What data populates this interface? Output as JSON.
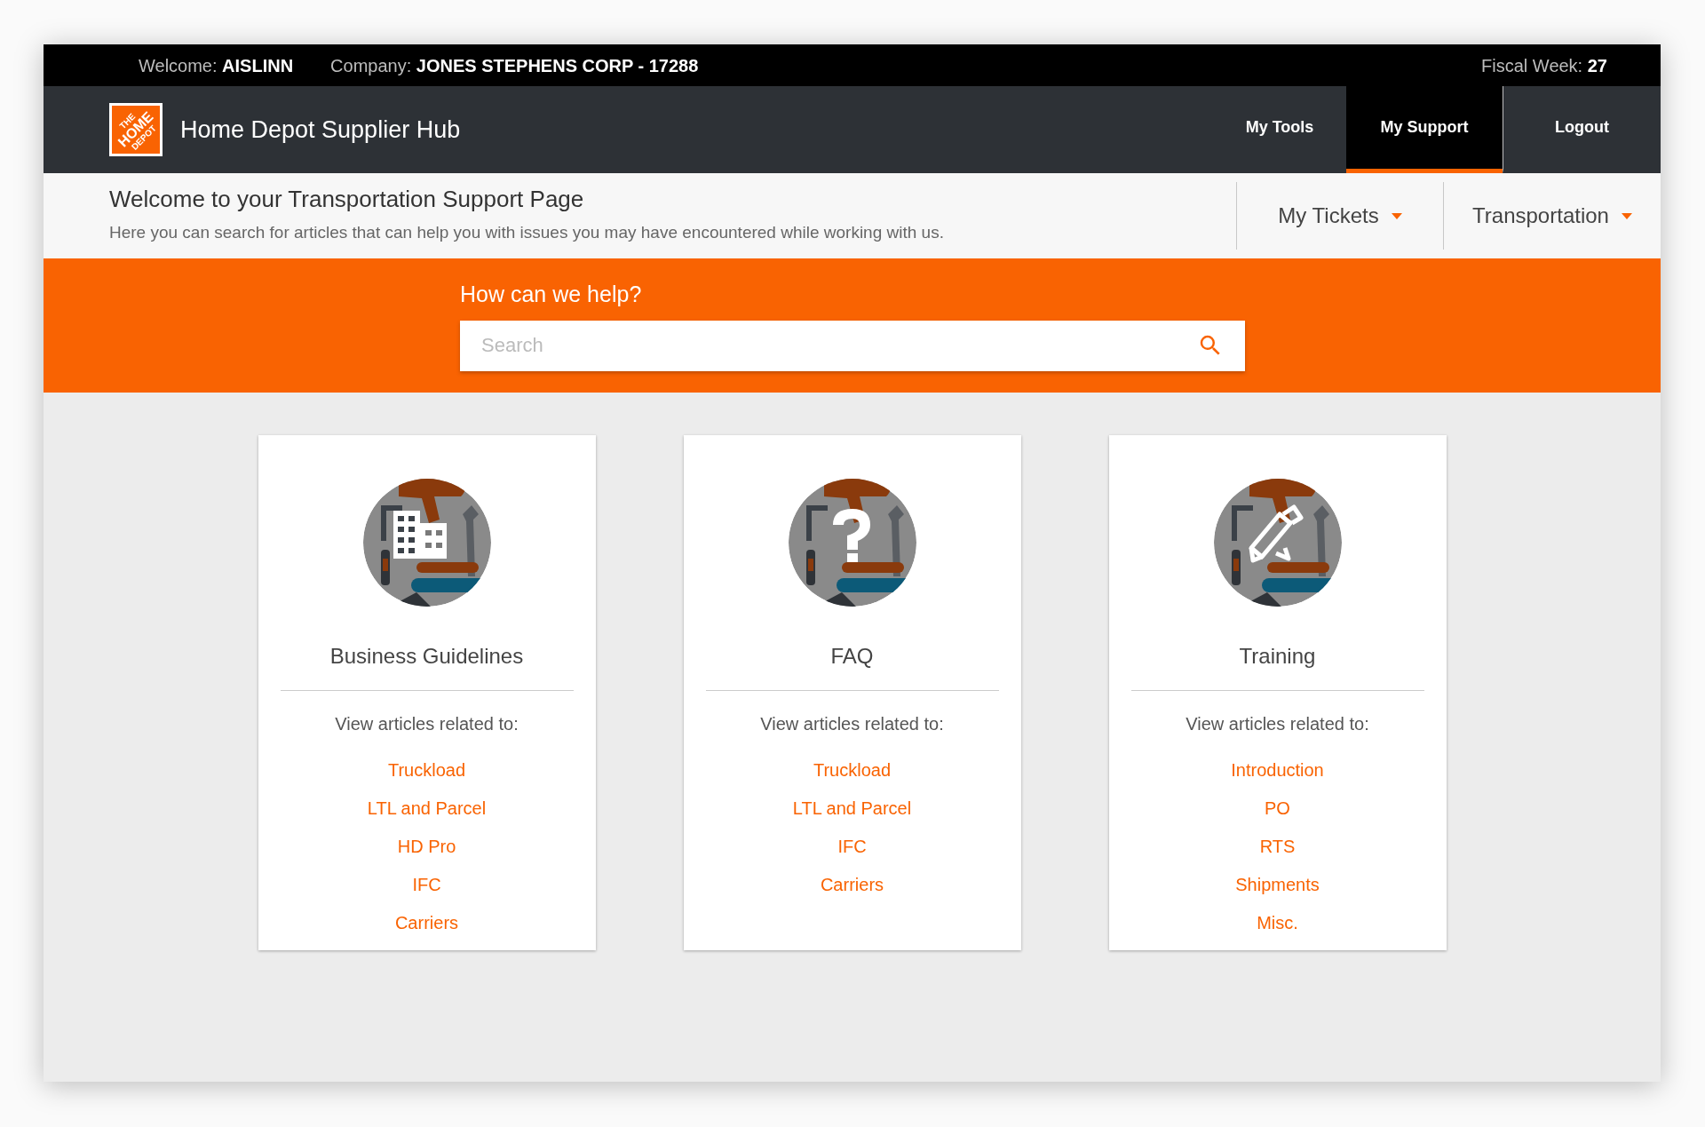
{
  "top_bar": {
    "welcome_label": "Welcome:",
    "welcome_value": "AISLINN",
    "company_label": "Company:",
    "company_value": "JONES STEPHENS CORP - 17288",
    "fiscal_label": "Fiscal Week:",
    "fiscal_value": "27"
  },
  "header": {
    "logo_lines": [
      "THE",
      "HOME",
      "DEPOT"
    ],
    "title": "Home Depot Supplier Hub",
    "nav": [
      {
        "label": "My Tools",
        "selected": false
      },
      {
        "label": "My Support",
        "selected": true
      },
      {
        "label": "Logout",
        "selected": false
      }
    ]
  },
  "subheader": {
    "title": "Welcome to your Transportation Support Page",
    "subtitle": "Here you can search for articles that can help you with issues you may have encountered while working with us.",
    "dropdowns": [
      "My Tickets",
      "Transportation"
    ]
  },
  "search": {
    "label": "How can we help?",
    "placeholder": "Search"
  },
  "cards": [
    {
      "kind": "building",
      "title": "Business Guidelines",
      "intro": "View articles related to:",
      "links": [
        "Truckload",
        "LTL and Parcel",
        "HD Pro",
        "IFC",
        "Carriers"
      ]
    },
    {
      "kind": "question",
      "title": "FAQ",
      "intro": "View articles related to:",
      "links": [
        "Truckload",
        "LTL and Parcel",
        "IFC",
        "Carriers"
      ]
    },
    {
      "kind": "pencil",
      "title": "Training",
      "intro": "View articles related to:",
      "links": [
        "Introduction",
        "PO",
        "RTS",
        "Shipments",
        "Misc."
      ]
    }
  ]
}
